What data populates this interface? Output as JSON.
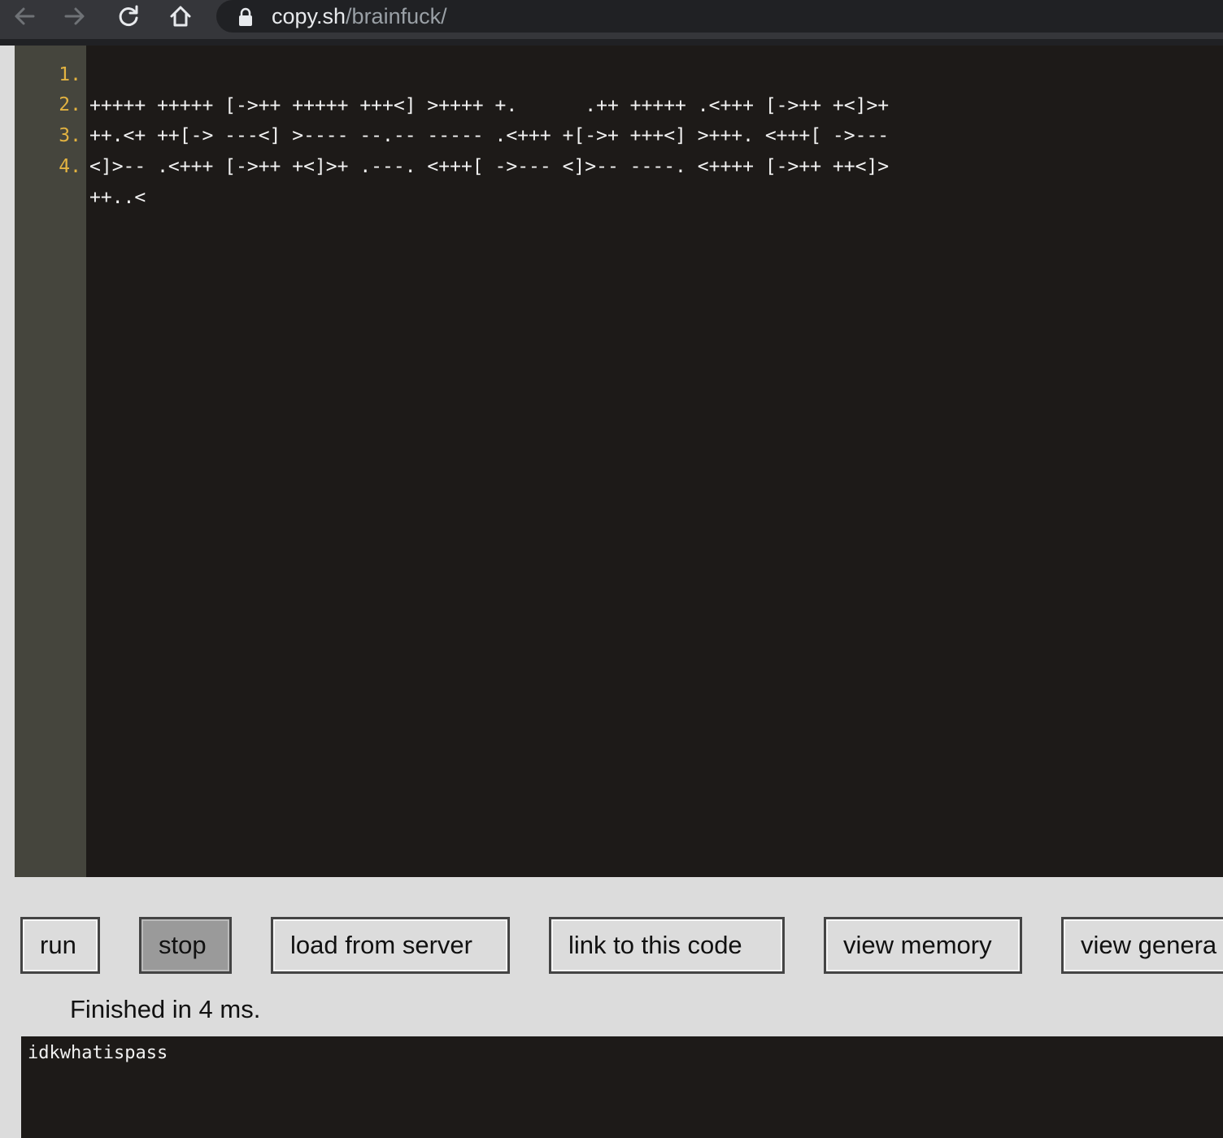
{
  "browser": {
    "url_host": "copy.sh",
    "url_path": "/brainfuck/",
    "icons": [
      "back-arrow-icon",
      "forward-arrow-icon",
      "reload-icon",
      "home-icon",
      "lock-icon"
    ]
  },
  "editor": {
    "lines": [
      {
        "num": "1.",
        "text": "+++++ +++++ [->++ +++++ +++<] >++++ +.      .++ +++++ .<+++ [->++ +<]>+"
      },
      {
        "num": "2.",
        "text": "++.<+ ++[-> ---<] >---- --.-- ----- .<+++ +[->+ +++<] >+++. <+++[ ->---"
      },
      {
        "num": "3.",
        "text": "<]>-- .<+++ [->++ +<]>+ .---. <+++[ ->--- <]>-- ----. <++++ [->++ ++<]>"
      },
      {
        "num": "4.",
        "text": "++..<"
      }
    ]
  },
  "buttons": {
    "run": "run",
    "stop": "stop",
    "load": "load from server",
    "link": "link to this code",
    "memory": "view memory",
    "generated": "view genera"
  },
  "status": "Finished in 4 ms.",
  "output": "idkwhatispass"
}
